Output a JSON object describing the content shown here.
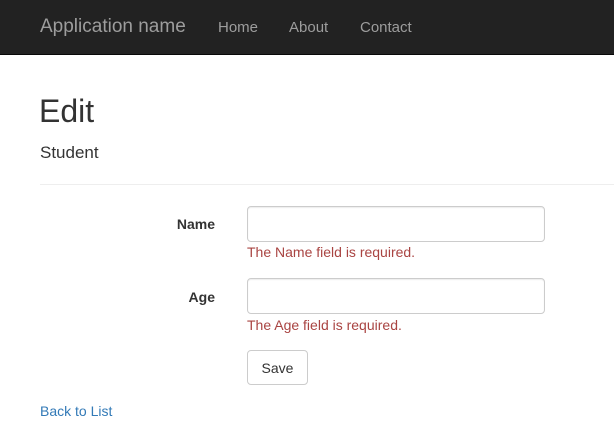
{
  "navbar": {
    "brand": "Application name",
    "links": [
      {
        "label": "Home"
      },
      {
        "label": "About"
      },
      {
        "label": "Contact"
      }
    ]
  },
  "page": {
    "title": "Edit",
    "subtitle": "Student"
  },
  "form": {
    "fields": [
      {
        "label": "Name",
        "value": "",
        "error": "The Name field is required."
      },
      {
        "label": "Age",
        "value": "",
        "error": "The Age field is required."
      }
    ],
    "save_label": "Save"
  },
  "footer_link": {
    "label": "Back to List"
  },
  "colors": {
    "navbar_bg": "#222222",
    "nav_text": "#9d9d9d",
    "error": "#a94442",
    "link": "#337ab7"
  }
}
